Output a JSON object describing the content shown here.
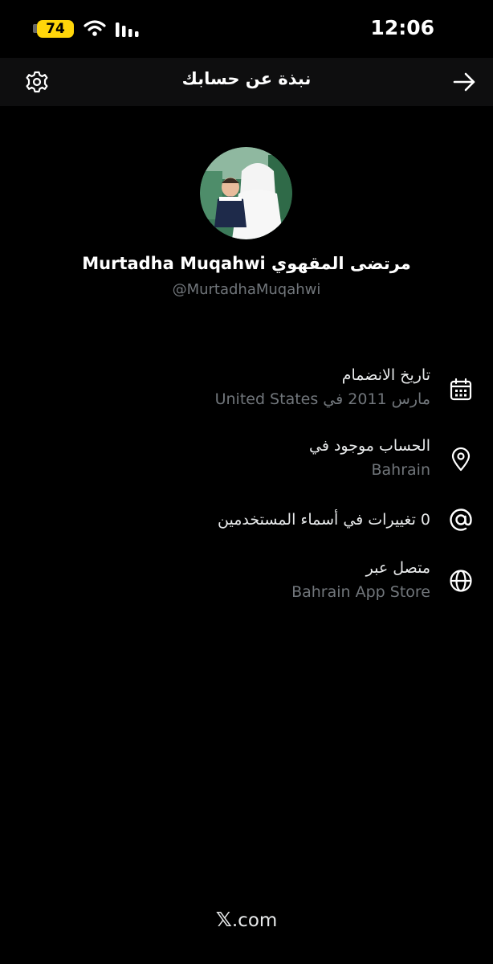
{
  "status_bar": {
    "battery": "74",
    "time": "12:06"
  },
  "header": {
    "title": "نبذة عن حسابك"
  },
  "profile": {
    "display_name": "مرتضى المقهوي Murtadha Muqahwi",
    "handle": "@MurtadhaMuqahwi"
  },
  "details": [
    {
      "label": "تاريخ الانضمام",
      "value": "مارس 2011 في United States",
      "icon": "calendar-icon"
    },
    {
      "label": "الحساب موجود في",
      "value": "Bahrain",
      "icon": "location-pin-icon"
    },
    {
      "label": "0 تغييرات في أسماء المستخدمين",
      "value": "",
      "icon": "at-sign-icon"
    },
    {
      "label": "متصل عبر",
      "value": "Bahrain App Store",
      "icon": "globe-icon"
    }
  ],
  "footer": {
    "x_mark": "𝕏",
    "domain": ".com"
  }
}
